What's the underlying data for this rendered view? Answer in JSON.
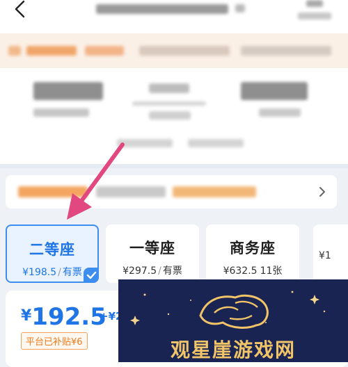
{
  "seats": [
    {
      "name": "二等座",
      "price": "¥198.5",
      "status": "有票",
      "selected": true
    },
    {
      "name": "一等座",
      "price": "¥297.5",
      "status": "有票",
      "selected": false
    },
    {
      "name": "商务座",
      "price": "¥632.5",
      "status": "11张",
      "selected": false
    },
    {
      "name": "",
      "price": "¥1",
      "status": "",
      "selected": false
    }
  ],
  "selected_price": {
    "currency": "¥",
    "amount": "192.5",
    "extra": "+¥2"
  },
  "subsidy_label": "平台已补贴¥6",
  "watermark_text": "观星崖游戏网",
  "colors": {
    "accent": "#1f74e6",
    "arrow": "#e0487f",
    "subsidy": "#f07a1a"
  },
  "icons": {
    "back": "chevron-left-icon",
    "promo_more": "chevron-right-icon",
    "check": "checkmark-icon",
    "logo": "fist-logo-icon"
  }
}
